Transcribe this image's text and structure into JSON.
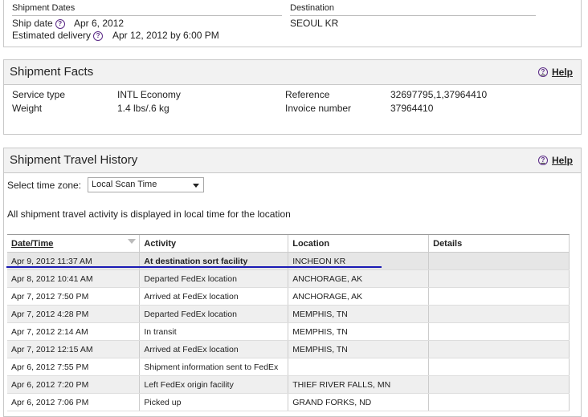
{
  "dates": {
    "heading": "Shipment Dates",
    "ship_date_label": "Ship date",
    "ship_date_value": "Apr 6, 2012",
    "est_delivery_label": "Estimated delivery",
    "est_delivery_value": "Apr 12, 2012 by 6:00 PM"
  },
  "destination": {
    "heading": "Destination",
    "value": "SEOUL KR"
  },
  "facts": {
    "title": "Shipment Facts",
    "help": "Help",
    "service_type_label": "Service type",
    "service_type_value": "INTL Economy",
    "weight_label": "Weight",
    "weight_value": "1.4 lbs/.6 kg",
    "reference_label": "Reference",
    "reference_value": "32697795,1,37964410",
    "invoice_label": "Invoice number",
    "invoice_value": "37964410"
  },
  "history": {
    "title": "Shipment Travel History",
    "help": "Help",
    "timezone_label": "Select time zone:",
    "timezone_value": "Local Scan Time",
    "note": "All shipment travel activity is displayed in local time for the location",
    "columns": [
      "Date/Time",
      "Activity",
      "Location",
      "Details"
    ],
    "rows": [
      {
        "datetime": "Apr 9, 2012 11:37 AM",
        "activity": "At destination sort facility",
        "location": "INCHEON KR",
        "details": ""
      },
      {
        "datetime": "Apr 8, 2012 10:41 AM",
        "activity": "Departed FedEx location",
        "location": "ANCHORAGE, AK",
        "details": ""
      },
      {
        "datetime": "Apr 7, 2012 7:50 PM",
        "activity": "Arrived at FedEx location",
        "location": "ANCHORAGE, AK",
        "details": ""
      },
      {
        "datetime": "Apr 7, 2012 4:28 PM",
        "activity": "Departed FedEx location",
        "location": "MEMPHIS, TN",
        "details": ""
      },
      {
        "datetime": "Apr 7, 2012 2:14 AM",
        "activity": "In transit",
        "location": "MEMPHIS, TN",
        "details": ""
      },
      {
        "datetime": "Apr 7, 2012 12:15 AM",
        "activity": "Arrived at FedEx location",
        "location": "MEMPHIS, TN",
        "details": ""
      },
      {
        "datetime": "Apr 6, 2012 7:55 PM",
        "activity": "Shipment information sent to FedEx",
        "location": "",
        "details": ""
      },
      {
        "datetime": "Apr 6, 2012 7:20 PM",
        "activity": "Left FedEx origin facility",
        "location": "THIEF RIVER FALLS, MN",
        "details": ""
      },
      {
        "datetime": "Apr 6, 2012 7:06 PM",
        "activity": "Picked up",
        "location": "GRAND FORKS, ND",
        "details": ""
      }
    ]
  },
  "icons": {
    "help": "question-circle-icon",
    "sort": "sort-caret-icon",
    "dropdown": "chevron-down-icon"
  },
  "colors": {
    "help_icon": "#5a2a86",
    "highlight_line": "#1a1ab4",
    "panel_header_bg": "#f2f2f2"
  }
}
